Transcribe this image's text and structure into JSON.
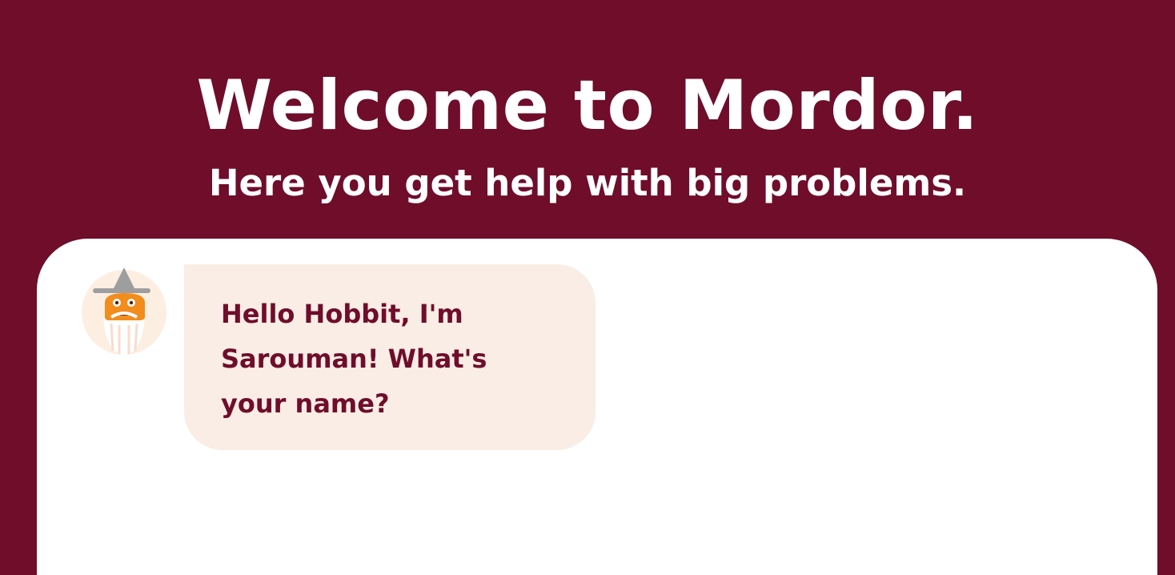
{
  "header": {
    "title": "Welcome to Mordor.",
    "subtitle": "Here you get help with big problems."
  },
  "chat": {
    "messages": [
      {
        "sender_avatar_icon": "wizard-avatar-icon",
        "text": "Hello Hobbit, I'm Sarouman! What's your name?"
      }
    ]
  },
  "colors": {
    "background": "#6f0d2b",
    "panel": "#ffffff",
    "bubble": "#f9ede5",
    "bubble_text": "#6f0d2b",
    "avatar_face": "#f28c1d",
    "avatar_hat": "#9e9e9e",
    "avatar_bg": "#fdeee2"
  }
}
